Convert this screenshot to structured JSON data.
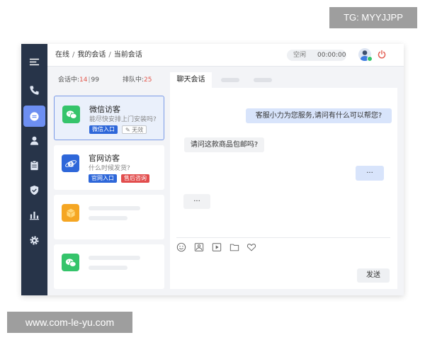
{
  "watermark": {
    "top_tag": "TG: MYYJJPP",
    "bottom_tag": "www.com-le-yu.com"
  },
  "colors": {
    "sidebar_bg": "#273449",
    "active_nav": "#6d8ff2",
    "agent_bubble": "#d8e4fb",
    "wechat_green": "#35c46b",
    "web_blue": "#2e67d9",
    "alert_red": "#e24d4d",
    "package_orange": "#f5a623"
  },
  "sidebar": {
    "items": [
      {
        "icon": "menu-icon",
        "active": false
      },
      {
        "icon": "phone-icon",
        "active": false
      },
      {
        "icon": "chat-icon",
        "active": true
      },
      {
        "icon": "user-icon",
        "active": false
      },
      {
        "icon": "clipboard-icon",
        "active": false
      },
      {
        "icon": "shield-icon",
        "active": false
      },
      {
        "icon": "bar-chart-icon",
        "active": false
      },
      {
        "icon": "gear-icon",
        "active": false
      }
    ]
  },
  "header": {
    "breadcrumb": [
      "在线",
      "我的会话",
      "当前会话"
    ],
    "separator": "/",
    "status": "空闲",
    "timer": "00:00:00"
  },
  "sessions": {
    "active_label": "会话中:",
    "active_count": "14",
    "active_divider": "|",
    "active_max": "99",
    "queue_label": "排队中:",
    "queue_count": "25",
    "cards": [
      {
        "channel_icon": "wechat-icon",
        "name": "微信访客",
        "preview": "能尽快安排上门安装吗?",
        "tags": [
          "微信入口",
          "无效"
        ],
        "selected": true
      },
      {
        "channel_icon": "ie-icon",
        "name": "官网访客",
        "preview": "什么时候发货?",
        "tags": [
          "官网入口",
          "售后咨询"
        ],
        "selected": false
      },
      {
        "channel_icon": "package-icon",
        "placeholder": true
      },
      {
        "channel_icon": "wechat-icon",
        "placeholder": true
      }
    ]
  },
  "chat": {
    "tabs": [
      "聊天会话"
    ],
    "messages": [
      {
        "from": "agent",
        "text": "客服小力为您服务,请问有什么可以帮您?"
      },
      {
        "from": "visitor",
        "text": "请问这款商品包邮吗?"
      },
      {
        "from": "agent",
        "text": "···"
      },
      {
        "from": "visitor",
        "text": "···"
      }
    ],
    "tools": [
      "emoji-icon",
      "image-icon",
      "video-icon",
      "folder-icon",
      "heart-icon"
    ],
    "send_label": "发送"
  }
}
